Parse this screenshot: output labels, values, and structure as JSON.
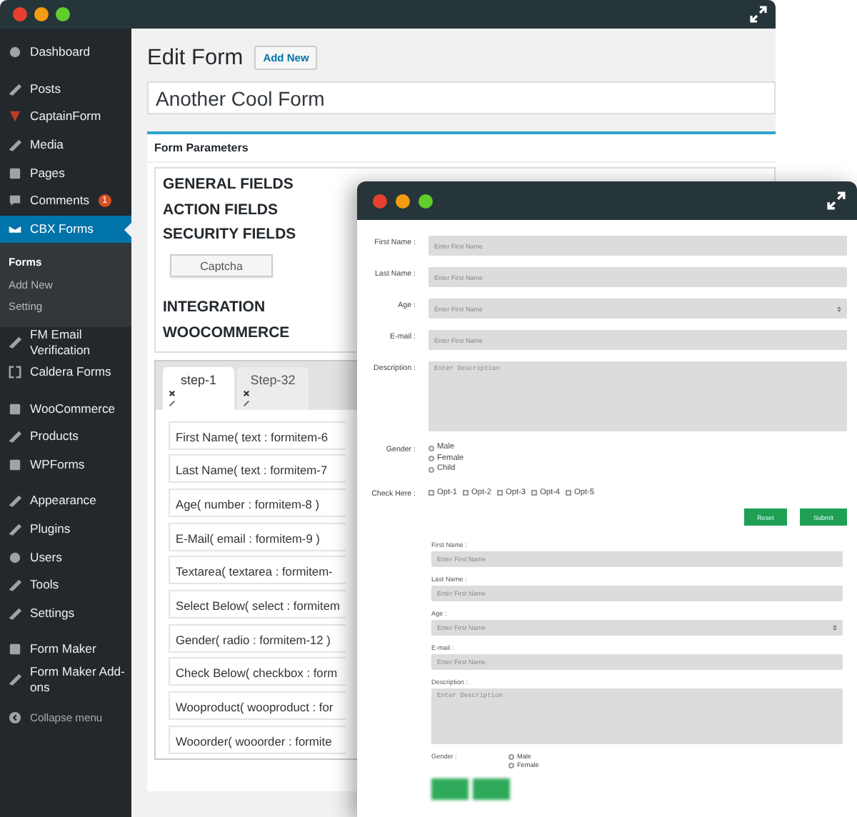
{
  "back_window": {
    "sidebar": {
      "groups": [
        [
          {
            "label": "Dashboard",
            "selected": false
          }
        ],
        [
          {
            "label": "Posts",
            "selected": false
          },
          {
            "label": "CaptainForm",
            "selected": false
          },
          {
            "label": "Media",
            "selected": false
          },
          {
            "label": "Pages",
            "selected": false
          },
          {
            "label": "Comments",
            "selected": false,
            "badge": "1"
          },
          {
            "label": "CBX Forms",
            "selected": true,
            "children": [
              {
                "label": "Forms",
                "selected": true
              },
              {
                "label": "Add New",
                "selected": false
              },
              {
                "label": "Setting",
                "selected": false
              }
            ]
          },
          {
            "label": "FM Email Verification",
            "selected": false
          },
          {
            "label": "Caldera Forms",
            "selected": false
          }
        ],
        [
          {
            "label": "WooCommerce",
            "selected": false
          },
          {
            "label": "Products",
            "selected": false
          },
          {
            "label": "WPForms",
            "selected": false
          }
        ],
        [
          {
            "label": "Appearance",
            "selected": false
          },
          {
            "label": "Plugins",
            "selected": false
          },
          {
            "label": "Users",
            "selected": false
          },
          {
            "label": "Tools",
            "selected": false
          },
          {
            "label": "Settings",
            "selected": false
          }
        ],
        [
          {
            "label": "Form Maker",
            "selected": false
          },
          {
            "label": "Form Maker Add-ons",
            "selected": false
          }
        ]
      ],
      "collapse": "Collapse menu"
    },
    "page_title": "Edit Form",
    "add_new": "Add New",
    "form_title": "Another Cool Form",
    "panel": {
      "title": "Form Parameters",
      "sections": [
        "GENERAL FIELDS",
        "ACTION FIELDS",
        "SECURITY FIELDS"
      ],
      "captcha": "Captcha",
      "sections_2": [
        "INTEGRATION",
        "WOOCOMMERCE"
      ]
    },
    "tabs": [
      {
        "label": "step-1",
        "selected": true
      },
      {
        "label": "Step-32",
        "selected": false
      }
    ],
    "fields": [
      "First Name( text : formitem-6",
      "Last Name( text : formitem-7",
      "Age( number : formitem-8 )",
      "E-Mail( email : formitem-9 )",
      "Textarea( textarea : formitem-",
      "Select Below( select : formitem",
      "Gender( radio : formitem-12 )",
      "Check Below( checkbox : form",
      "Wooproduct( wooproduct : for",
      "Wooorder( wooorder : formite"
    ]
  },
  "preview_window": {
    "form": [
      {
        "kind": "text",
        "label": "First Name :",
        "placeholder": "Enter First Name"
      },
      {
        "kind": "text",
        "label": "Last Name :",
        "placeholder": "Enter First Name"
      },
      {
        "kind": "number",
        "label": "Age :",
        "placeholder": "Enter First Name"
      },
      {
        "kind": "text",
        "label": "E-mail :",
        "placeholder": "Enter First Name"
      },
      {
        "kind": "textarea",
        "label": "Description :",
        "placeholder": "Enter Description"
      },
      {
        "kind": "radio",
        "label": "Gender :",
        "options": [
          {
            "label": "Male",
            "selected": false
          },
          {
            "label": "Female",
            "selected": false
          },
          {
            "label": "Child",
            "selected": false
          }
        ]
      },
      {
        "kind": "checkbox",
        "label": "Check Here :",
        "options": [
          {
            "label": "Opt-1",
            "checked": false
          },
          {
            "label": "Opt-2",
            "checked": false
          },
          {
            "label": "Opt-3",
            "checked": false
          },
          {
            "label": "Opt-4",
            "checked": false
          },
          {
            "label": "Opt-5",
            "checked": false
          }
        ]
      }
    ],
    "buttons": [
      "Reset",
      "Submit"
    ],
    "form_2": [
      {
        "kind": "text",
        "label": "First Name :",
        "placeholder": "Enter First Name"
      },
      {
        "kind": "text",
        "label": "Last Name :",
        "placeholder": "Enter First Name"
      },
      {
        "kind": "number",
        "label": "Age :",
        "placeholder": "Enter First Name"
      },
      {
        "kind": "text",
        "label": "E-mail :",
        "placeholder": "Enter First Name"
      },
      {
        "kind": "textarea",
        "label": "Description :",
        "placeholder": "Enter Description"
      },
      {
        "kind": "radio",
        "label": "Gender :",
        "options": [
          {
            "label": "Male",
            "selected": false
          },
          {
            "label": "Female",
            "selected": false
          }
        ]
      }
    ]
  }
}
